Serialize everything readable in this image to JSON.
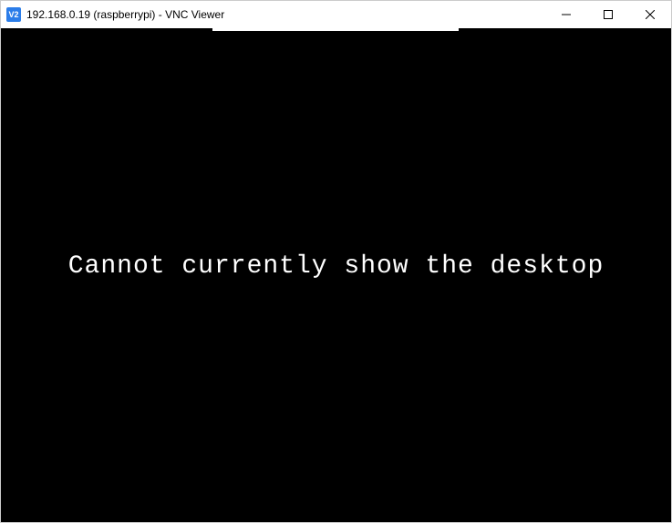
{
  "titlebar": {
    "icon_label": "V2",
    "title": "192.168.0.19 (raspberrypi) - VNC Viewer"
  },
  "content": {
    "error_message": "Cannot currently show the desktop"
  }
}
